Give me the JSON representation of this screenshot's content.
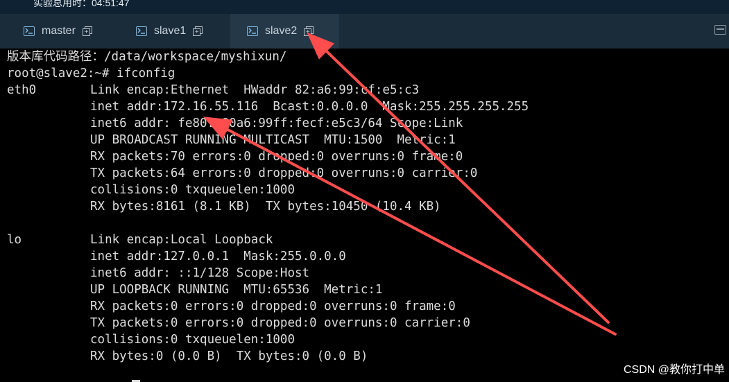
{
  "topbar": {
    "timer_text": "实验总用时：04:51:47"
  },
  "tabs": [
    {
      "label": "master"
    },
    {
      "label": "slave1"
    },
    {
      "label": "slave2",
      "active": true
    }
  ],
  "terminal": {
    "lines": [
      "版本库代码路径：/data/workspace/myshixun/",
      "root@slave2:~# ifconfig"
    ],
    "eth0": {
      "name": "eth0",
      "lines": [
        "Link encap:Ethernet  HWaddr 82:a6:99:cf:e5:c3",
        "inet addr:172.16.55.116  Bcast:0.0.0.0  Mask:255.255.255.255",
        "inet6 addr: fe80::80a6:99ff:fecf:e5c3/64 Scope:Link",
        "UP BROADCAST RUNNING MULTICAST  MTU:1500  Metric:1",
        "RX packets:70 errors:0 dropped:0 overruns:0 frame:0",
        "TX packets:64 errors:0 dropped:0 overruns:0 carrier:0",
        "collisions:0 txqueuelen:1000",
        "RX bytes:8161 (8.1 KB)  TX bytes:10450 (10.4 KB)"
      ]
    },
    "lo": {
      "name": "lo",
      "lines": [
        "Link encap:Local Loopback",
        "inet addr:127.0.0.1  Mask:255.0.0.0",
        "inet6 addr: ::1/128 Scope:Host",
        "UP LOOPBACK RUNNING  MTU:65536  Metric:1",
        "RX packets:0 errors:0 dropped:0 overruns:0 frame:0",
        "TX packets:0 errors:0 dropped:0 overruns:0 carrier:0",
        "collisions:0 txqueuelen:1000",
        "RX bytes:0 (0.0 B)  TX bytes:0 (0.0 B)"
      ]
    }
  },
  "watermark": "CSDN @教你打中单",
  "colors": {
    "arrow": "#ff4d4d",
    "tab_icon": "#7fb7e0"
  },
  "icons": {
    "terminal_tab": "terminal-icon",
    "duplicate": "duplicate-icon",
    "right": "panel-icon"
  }
}
